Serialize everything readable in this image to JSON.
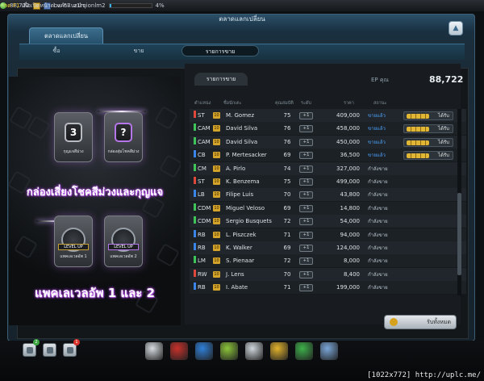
{
  "topbar": {
    "hint_key": "กด F1",
    "hint_text": " เพื่อเปิดหน้าต่างคำแนะนำ",
    "ep_amount": "88,722",
    "level": "Lv. 67",
    "username": "z1rqionlm2",
    "progress_label": "4%",
    "progress_value": 0.04
  },
  "window": {
    "title": "ตลาดแลกเปลี่ยน",
    "main_tab": "ตลาดแลกเปลี่ยน",
    "close_icon": "triangle-eject-icon"
  },
  "subtabs": [
    {
      "label": "ซื้อ",
      "active": false
    },
    {
      "label": "ขาย",
      "active": false
    },
    {
      "label": "รายการขาย",
      "active": true
    }
  ],
  "promo": {
    "card1_badge": "3",
    "card1_label": "กุญแจสีม่วง",
    "card2_badge": "?",
    "card2_label": "กล่องสุ่มโชคสีม่วง",
    "headline1": "กล่องเสี่ยงโชคสีม่วงและกุญแจ",
    "card3_label": "แพคเลเวลอัพ 1",
    "card4_label": "แพคเลเวลอัพ 2",
    "card3_band": "LEVEL UP",
    "card4_band": "LEVEL UP",
    "headline2": "แพคเลเวลอัพ 1 และ 2"
  },
  "panel": {
    "tab": "รายการขาย",
    "ep_label": "EP คุณ",
    "ep_value": "88,722",
    "collect_button": "รับทั้งหมด"
  },
  "table": {
    "headers": [
      "ตำแหน่ง",
      "ชื่อนักเตะ",
      "คุณสมบัติ",
      "ระดับ",
      "ราคา",
      "สถานะ"
    ],
    "rows": [
      {
        "pos": "ST",
        "pos_color": "#e0483c",
        "name": "M. Gomez",
        "ovr": "75",
        "lvl": "+1",
        "price": "409,000",
        "status": "ขายแล้ว",
        "status_color": "#4da3ff",
        "action": "ได้รับ"
      },
      {
        "pos": "CAM",
        "pos_color": "#3fc45a",
        "name": "David Silva",
        "ovr": "76",
        "lvl": "+1",
        "price": "458,000",
        "status": "ขายแล้ว",
        "status_color": "#4da3ff",
        "action": "ได้รับ"
      },
      {
        "pos": "CAM",
        "pos_color": "#3fc45a",
        "name": "David Silva",
        "ovr": "76",
        "lvl": "+1",
        "price": "450,000",
        "status": "ขายแล้ว",
        "status_color": "#4da3ff",
        "action": "ได้รับ"
      },
      {
        "pos": "CB",
        "pos_color": "#3a86e8",
        "name": "P. Mertesacker",
        "ovr": "69",
        "lvl": "+1",
        "price": "36,500",
        "status": "ขายแล้ว",
        "status_color": "#4da3ff",
        "action": "ได้รับ"
      },
      {
        "pos": "CM",
        "pos_color": "#3fc45a",
        "name": "A. Pirlo",
        "ovr": "74",
        "lvl": "+1",
        "price": "327,000",
        "status": "กำลังขาย",
        "status_color": "#b8c4cc",
        "action": ""
      },
      {
        "pos": "ST",
        "pos_color": "#e0483c",
        "name": "K. Benzema",
        "ovr": "75",
        "lvl": "+1",
        "price": "499,000",
        "status": "กำลังขาย",
        "status_color": "#b8c4cc",
        "action": ""
      },
      {
        "pos": "LB",
        "pos_color": "#3a86e8",
        "name": "Filipe Luis",
        "ovr": "70",
        "lvl": "+1",
        "price": "43,800",
        "status": "กำลังขาย",
        "status_color": "#b8c4cc",
        "action": ""
      },
      {
        "pos": "CDM",
        "pos_color": "#3fc45a",
        "name": "Miguel Veloso",
        "ovr": "69",
        "lvl": "+1",
        "price": "14,800",
        "status": "กำลังขาย",
        "status_color": "#b8c4cc",
        "action": ""
      },
      {
        "pos": "CDM",
        "pos_color": "#3fc45a",
        "name": "Sergio Busquets",
        "ovr": "72",
        "lvl": "+1",
        "price": "54,000",
        "status": "กำลังขาย",
        "status_color": "#b8c4cc",
        "action": ""
      },
      {
        "pos": "RB",
        "pos_color": "#3a86e8",
        "name": "L. Piszczek",
        "ovr": "71",
        "lvl": "+1",
        "price": "94,000",
        "status": "กำลังขาย",
        "status_color": "#b8c4cc",
        "action": ""
      },
      {
        "pos": "RB",
        "pos_color": "#3a86e8",
        "name": "K. Walker",
        "ovr": "69",
        "lvl": "+1",
        "price": "124,000",
        "status": "กำลังขาย",
        "status_color": "#b8c4cc",
        "action": ""
      },
      {
        "pos": "LM",
        "pos_color": "#3fc45a",
        "name": "S. Pienaar",
        "ovr": "72",
        "lvl": "+1",
        "price": "8,000",
        "status": "กำลังขาย",
        "status_color": "#b8c4cc",
        "action": ""
      },
      {
        "pos": "RW",
        "pos_color": "#e0483c",
        "name": "J. Lens",
        "ovr": "70",
        "lvl": "+1",
        "price": "8,400",
        "status": "กำลังขาย",
        "status_color": "#b8c4cc",
        "action": ""
      },
      {
        "pos": "RB",
        "pos_color": "#3a86e8",
        "name": "I. Abate",
        "ovr": "71",
        "lvl": "+1",
        "price": "199,000",
        "status": "กำลังขาย",
        "status_color": "#b8c4cc",
        "action": ""
      }
    ]
  },
  "dock": {
    "left_buttons": [
      {
        "icon": "friends-icon",
        "badge": "2",
        "badge_color": "#3aa53e"
      },
      {
        "icon": "chat-icon",
        "badge": "",
        "badge_color": ""
      },
      {
        "icon": "mail-icon",
        "badge": "1",
        "badge_color": "#d8322a"
      }
    ],
    "items": [
      {
        "icon": "whistle-icon",
        "color": "#d7dce0"
      },
      {
        "icon": "ball-icon",
        "color": "#c8312b"
      },
      {
        "icon": "boots-icon",
        "color": "#2f7fd8"
      },
      {
        "icon": "cone-icon",
        "color": "#8bc43a"
      },
      {
        "icon": "clipboard-icon",
        "color": "#cfd6dc"
      },
      {
        "icon": "trophy-icon",
        "color": "#e2b22c"
      },
      {
        "icon": "coin-shop-icon",
        "color": "#3db04a"
      },
      {
        "icon": "cart-icon",
        "color": "#7aa6d8"
      }
    ]
  },
  "watermark": "[1022x772]  http://uplc.me/"
}
